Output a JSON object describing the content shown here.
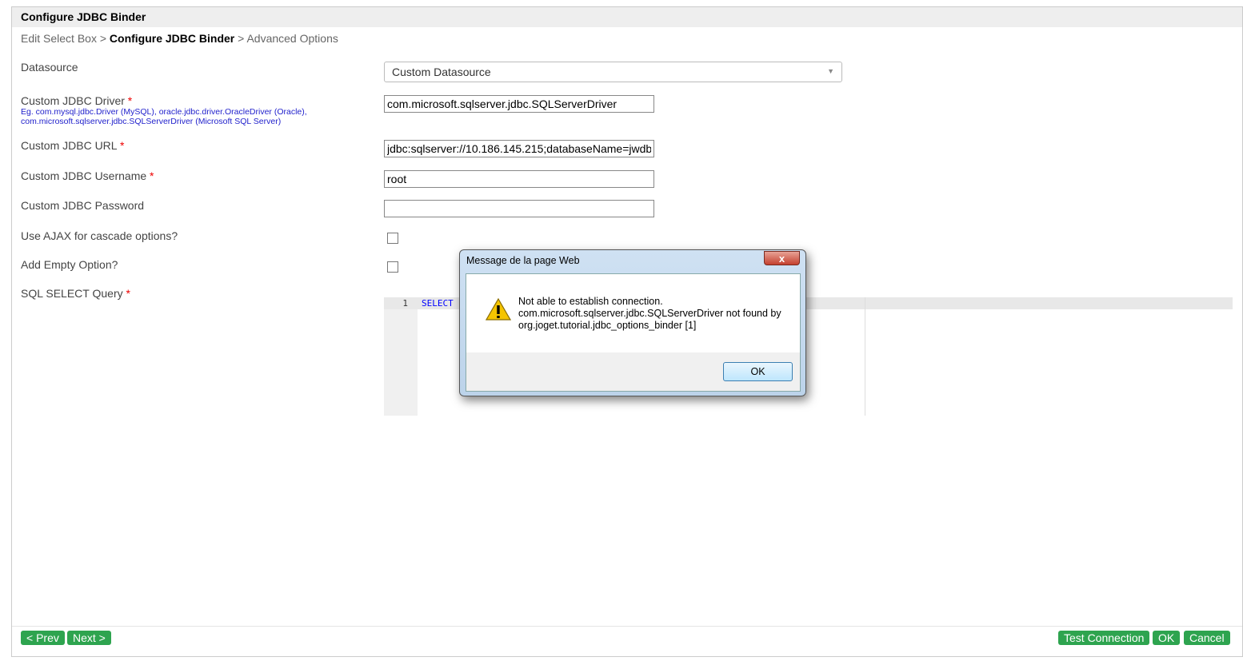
{
  "header": {
    "title": "Configure JDBC Binder"
  },
  "breadcrumb": {
    "step1": "Edit Select Box",
    "sep": ">",
    "step2": "Configure JDBC Binder",
    "step3": "Advanced Options"
  },
  "fields": {
    "datasource": {
      "label": "Datasource",
      "value": "Custom Datasource"
    },
    "driver": {
      "label": "Custom JDBC Driver",
      "required": "*",
      "hint1": "Eg. com.mysql.jdbc.Driver (MySQL), oracle.jdbc.driver.OracleDriver (Oracle),",
      "hint2": "com.microsoft.sqlserver.jdbc.SQLServerDriver (Microsoft SQL Server)",
      "value": "com.microsoft.sqlserver.jdbc.SQLServerDriver"
    },
    "url": {
      "label": "Custom JDBC URL",
      "required": "*",
      "value": "jdbc:sqlserver://10.186.145.215;databaseName=jwdb"
    },
    "username": {
      "label": "Custom JDBC Username",
      "required": "*",
      "value": "root"
    },
    "password": {
      "label": "Custom JDBC Password",
      "value": ""
    },
    "ajax": {
      "label": "Use AJAX for cascade options?",
      "checked": false
    },
    "empty": {
      "label": "Add Empty Option?",
      "checked": false
    },
    "sql": {
      "label": "SQL SELECT Query",
      "required": "*",
      "line_number": "1",
      "code": "SELECT"
    }
  },
  "footer": {
    "prev": "< Prev",
    "next": "Next >",
    "test": "Test Connection",
    "ok": "OK",
    "cancel": "Cancel"
  },
  "dialog": {
    "title": "Message de la page Web",
    "close": "x",
    "line1": "Not able to establish connection.",
    "line2": "com.microsoft.sqlserver.jdbc.SQLServerDriver not found by",
    "line3": "org.joget.tutorial.jdbc_options_binder [1]",
    "ok": "OK"
  }
}
